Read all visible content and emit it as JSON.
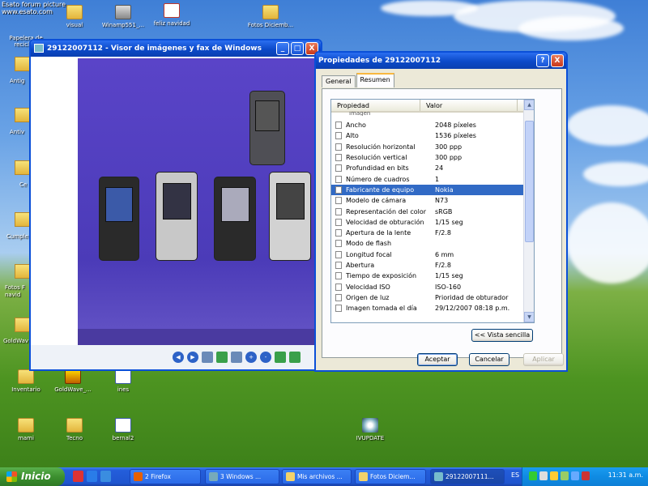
{
  "watermark": {
    "line1": "Esato forum picture",
    "line2": "www.esato.com"
  },
  "desktop_icons": [
    {
      "label": "Papelera de reciclaje",
      "icon": "recycle-bin-icon"
    },
    {
      "label": "visual",
      "icon": "folder-icon"
    },
    {
      "label": "Winamp551_...",
      "icon": "installer-icon"
    },
    {
      "label": "feliz navidad",
      "icon": "document-icon"
    },
    {
      "label": "Fotos Diciemb...",
      "icon": "folder-icon"
    },
    {
      "label": "Antig",
      "icon": "folder-icon"
    },
    {
      "label": "Antiv",
      "icon": "folder-icon"
    },
    {
      "label": "Ce",
      "icon": "folder-icon"
    },
    {
      "label": "Cumple",
      "icon": "folder-icon"
    },
    {
      "label": "Fotos F navid",
      "icon": "folder-icon"
    },
    {
      "label": "GoldWav",
      "icon": "folder-icon"
    },
    {
      "label": "Inventario",
      "icon": "folder-icon"
    },
    {
      "label": "GoldWave_...",
      "icon": "goldwave-icon"
    },
    {
      "label": "ines",
      "icon": "document-icon"
    },
    {
      "label": "mami",
      "icon": "folder-icon"
    },
    {
      "label": "Tecno",
      "icon": "folder-icon"
    },
    {
      "label": "bernal2",
      "icon": "word-document-icon"
    },
    {
      "label": "IVUPDATE",
      "icon": "cd-icon"
    }
  ],
  "viewer": {
    "title": "29122007112 - Visor de imágenes y fax de Windows",
    "controls": {
      "minimize": "_",
      "maximize": "□",
      "close": "X"
    }
  },
  "dialog": {
    "title": "Propiedades de 29122007112",
    "help": "?",
    "close": "X",
    "tabs": [
      {
        "label": "General",
        "active": false
      },
      {
        "label": "Resumen",
        "active": true
      }
    ],
    "list": {
      "col_property": "Propiedad",
      "col_value": "Valor",
      "partial_header": "Imagen",
      "rows": [
        {
          "k": "Ancho",
          "v": "2048 píxeles"
        },
        {
          "k": "Alto",
          "v": "1536 píxeles"
        },
        {
          "k": "Resolución horizontal",
          "v": "300 ppp"
        },
        {
          "k": "Resolución vertical",
          "v": "300 ppp"
        },
        {
          "k": "Profundidad en bits",
          "v": "24"
        },
        {
          "k": "Número de cuadros",
          "v": "1"
        },
        {
          "k": "Fabricante de equipo",
          "v": "Nokia",
          "selected": true
        },
        {
          "k": "Modelo de cámara",
          "v": "N73"
        },
        {
          "k": "Representación del color",
          "v": "sRGB"
        },
        {
          "k": "Velocidad de obturación",
          "v": "1/15 seg"
        },
        {
          "k": "Apertura de la lente",
          "v": "F/2.8"
        },
        {
          "k": "Modo de flash",
          "v": ""
        },
        {
          "k": "Longitud focal",
          "v": "6 mm"
        },
        {
          "k": "Abertura",
          "v": "F/2.8"
        },
        {
          "k": "Tiempo de exposición",
          "v": "1/15 seg"
        },
        {
          "k": "Velocidad ISO",
          "v": "ISO-160"
        },
        {
          "k": "Origen de luz",
          "v": "Prioridad de obturador"
        },
        {
          "k": "Imagen tomada el día",
          "v": "29/12/2007 08:18 p.m."
        }
      ]
    },
    "simple_view_button": "<< Vista sencilla",
    "ok_button": "Aceptar",
    "cancel_button": "Cancelar",
    "apply_button": "Aplicar"
  },
  "taskbar": {
    "start_label": "Inicio",
    "tasks": [
      {
        "label": "2 Firefox"
      },
      {
        "label": "3 Windows ..."
      },
      {
        "label": "Mis archivos ..."
      },
      {
        "label": "Fotos Diciem..."
      },
      {
        "label": "29122007111..."
      }
    ],
    "language": "ES",
    "clock": "11:31 a.m."
  }
}
